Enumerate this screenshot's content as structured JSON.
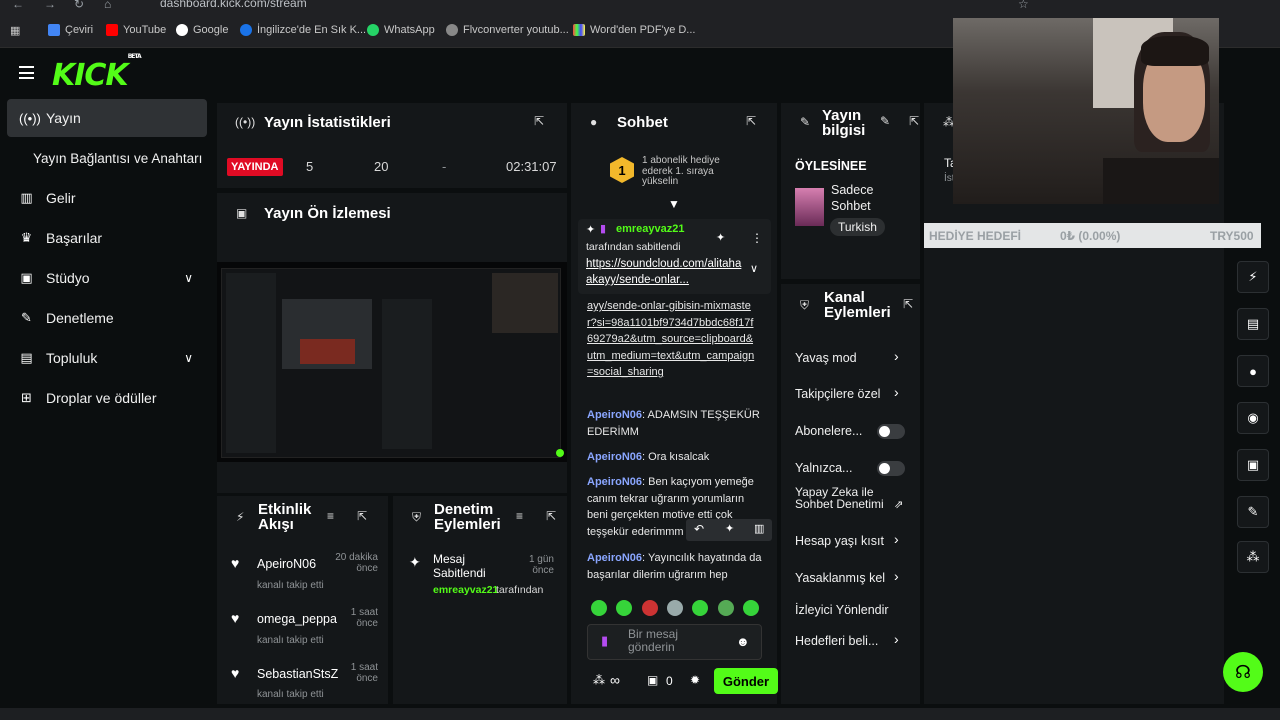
{
  "browser": {
    "url": "dashboard.kick.com/stream",
    "bookmarks": [
      "Çeviri",
      "YouTube",
      "Google",
      "İngilizce'de En Sık K...",
      "WhatsApp",
      "Flvconverter youtub...",
      "Word'den PDF'ye D..."
    ]
  },
  "brand": {
    "logo": "KICK",
    "badge": "BETA",
    "accent": "#53fc18"
  },
  "sidebar": {
    "items": [
      {
        "label": "Yayın",
        "icon": "broadcast-icon"
      },
      {
        "label": "Yayın Bağlantısı ve Anahtarı",
        "icon": ""
      },
      {
        "label": "Gelir",
        "icon": "chart-icon"
      },
      {
        "label": "Başarılar",
        "icon": "trophy-icon"
      },
      {
        "label": "Stüdyo",
        "icon": "studio-icon"
      },
      {
        "label": "Denetleme",
        "icon": "wrench-icon"
      },
      {
        "label": "Topluluk",
        "icon": "users-icon"
      },
      {
        "label": "Droplar ve ödüller",
        "icon": "drops-icon"
      }
    ]
  },
  "stats": {
    "title": "Yayın İstatistikleri",
    "live_badge": "YAYINDA",
    "viewers": "5",
    "followers": "20",
    "dash": "-",
    "duration": "02:31:07"
  },
  "preview": {
    "title": "Yayın Ön İzlemesi"
  },
  "activity": {
    "title": "Etkinlik Akışı",
    "items": [
      {
        "user": "ApeiroN06",
        "action": "kanalı takip etti",
        "time": "20 dakika önce"
      },
      {
        "user": "omega_peppa",
        "action": "kanalı takip etti",
        "time": "1 saat önce"
      },
      {
        "user": "SebastianStsZ",
        "action": "kanalı takip etti",
        "time": "1 saat önce"
      }
    ]
  },
  "moderation": {
    "title": "Denetim Eylemleri",
    "item_title": "Mesaj Sabitlendi",
    "item_user": "emreayvaz21",
    "item_suffix": "tarafından",
    "item_time": "1 gün önce"
  },
  "chat": {
    "title": "Sohbet",
    "hype_text": "1 abonelik hediye ederek 1. sıraya yükselin",
    "hype_number": "1",
    "pinned_user": "emreayvaz21",
    "pinned_by": "tarafından sabitlendi",
    "pinned_link": "https://soundcloud.com/alitahaakayy/sende-onlar...",
    "link_continuation": "ayy/sende-onlar-gibisin-mixmaster?si=98a1101bf9734d7bbdc68f17f69279a2&utm_source=clipboard&utm_medium=text&utm_campaign=social_sharing",
    "messages": [
      {
        "user": "ApeiroN06",
        "text": ": ADAMSIN TEŞŞEKÜR EDERİMM"
      },
      {
        "user": "ApeiroN06",
        "text": ": Ora kısalcak"
      },
      {
        "user": "ApeiroN06",
        "text": ": Ben kaçıyom yemeğe canım tekrar uğrarım yorumların beni gerçekten motive etti çok teşşekür ederimmm"
      },
      {
        "user": "ApeiroN06",
        "text": ": Yayıncılık hayatında da başarılar dilerim uğrarım hep"
      }
    ],
    "input_placeholder": "Bir mesaj gönderin",
    "infinity": "∞",
    "count": "0",
    "send_label": "Gönder"
  },
  "stream_info": {
    "title": "Yayın bilgisi",
    "stream_title": "ÖYLESİNEE",
    "category": "Sadece Sohbet",
    "tag": "Turkish"
  },
  "channel_actions": {
    "title": "Kanal Eylemleri",
    "items": [
      {
        "label": "Yavaş mod",
        "kind": "arrow"
      },
      {
        "label": "Takipçilere özel",
        "kind": "arrow"
      },
      {
        "label": "Abonelere...",
        "kind": "toggle"
      },
      {
        "label": "Yalnızca...",
        "kind": "toggle"
      },
      {
        "label": "Yapay Zeka ile Sohbet Denetimi",
        "kind": "external"
      },
      {
        "label": "Hesap yaşı kısıt",
        "kind": "arrow"
      },
      {
        "label": "Yasaklanmış kel",
        "kind": "arrow"
      },
      {
        "label": "İzleyici Yönlendir",
        "kind": "none"
      },
      {
        "label": "Hedefleri beli...",
        "kind": "arrow"
      }
    ]
  },
  "goal": {
    "label": "HEDİYE HEDEFİ",
    "value": "0₺ (0.00%)",
    "target": "TRY500"
  },
  "partial_panel": {
    "text1": "Ta",
    "text2": "İst"
  }
}
